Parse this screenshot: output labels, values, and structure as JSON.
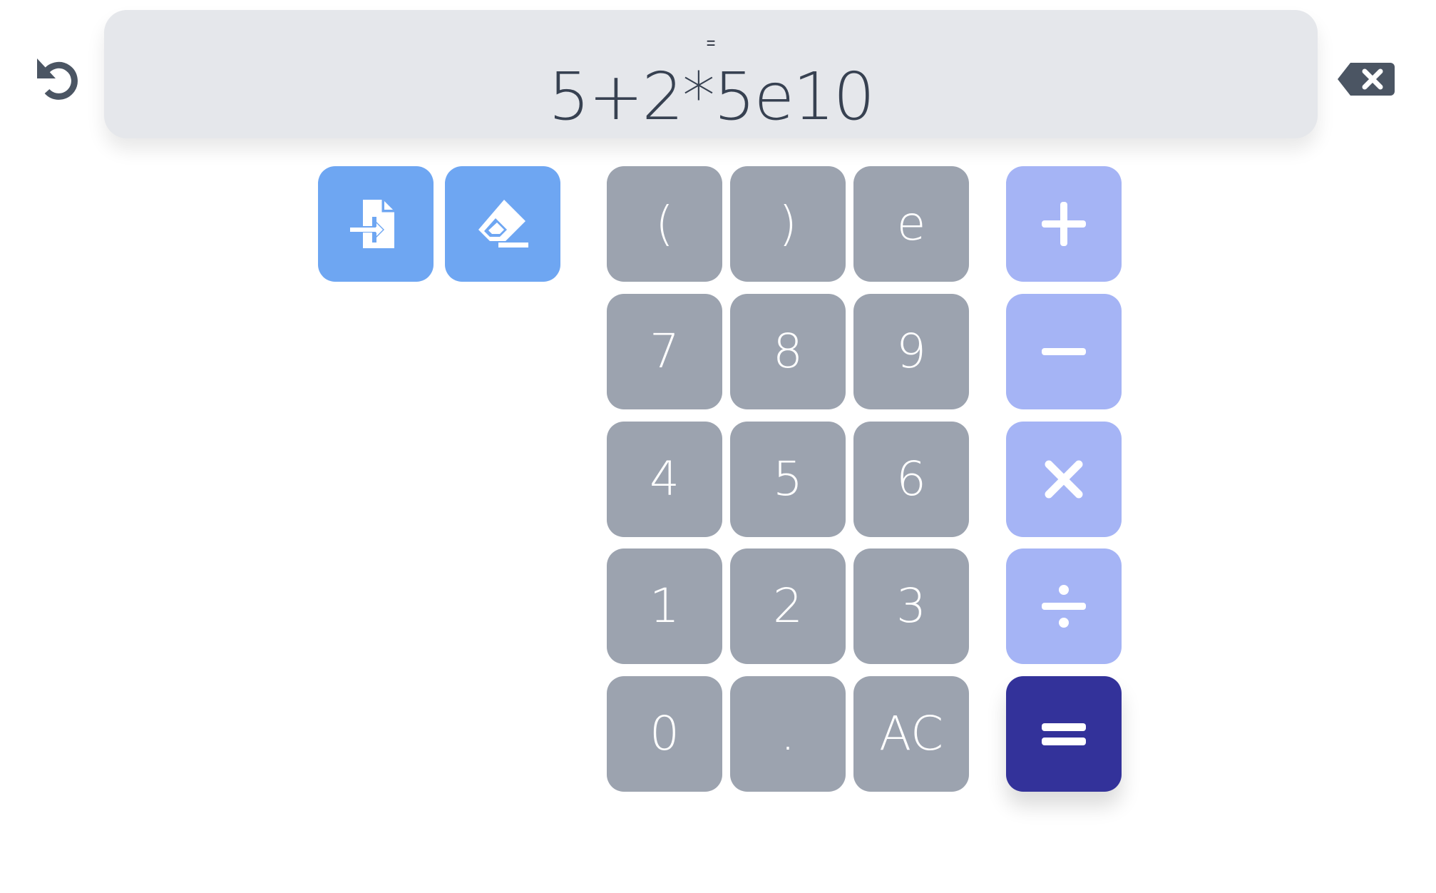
{
  "display": {
    "hint": "=",
    "expression": "5+2*5e10"
  },
  "icons": {
    "undo": "undo-arrow-icon",
    "backspace": "backspace-x-icon",
    "insert": "file-import-icon",
    "erase": "eraser-icon",
    "add": "plus-icon",
    "subtract": "minus-icon",
    "multiply": "times-icon",
    "divide": "divide-icon",
    "equals": "equals-icon"
  },
  "keys": {
    "paren_open": "(",
    "paren_close": ")",
    "e": "e",
    "seven": "7",
    "eight": "8",
    "nine": "9",
    "four": "4",
    "five": "5",
    "six": "6",
    "one": "1",
    "two": "2",
    "three": "3",
    "zero": "0",
    "dot": ".",
    "clear": "AC"
  },
  "colors": {
    "display_bg": "#e5e7eb",
    "key_bg": "#9ca3af",
    "tool_bg": "#6ea6f2",
    "operator_bg": "#a5b4f5",
    "equals_bg": "#33329a",
    "icon_dark": "#4b5563"
  }
}
